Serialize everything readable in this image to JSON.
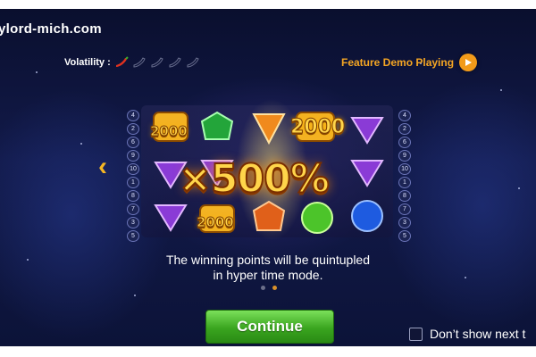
{
  "watermark": "ylord-mich.com",
  "volatility": {
    "label": "Volatility :",
    "level": 1,
    "max": 5
  },
  "feature": {
    "label": "Feature Demo Playing",
    "icon": "play-icon"
  },
  "paylines": {
    "left": [
      "4",
      "2",
      "6",
      "9",
      "10",
      "1",
      "8",
      "7",
      "3",
      "5"
    ],
    "right": [
      "4",
      "2",
      "6",
      "9",
      "10",
      "1",
      "8",
      "7",
      "3",
      "5"
    ]
  },
  "reels": {
    "symbol_values": [
      "2000",
      "2000",
      "2000"
    ]
  },
  "multiplier": "×500%",
  "caption": {
    "line1": "The winning points will be quintupled",
    "line2": "in hyper time mode."
  },
  "pagination": {
    "total": 2,
    "current": 2
  },
  "continue_label": "Continue",
  "dont_show_label": "Don’t show next t",
  "colors": {
    "accent": "#f5a623",
    "button": "#3aa51f",
    "gold": "#ffd54a"
  }
}
